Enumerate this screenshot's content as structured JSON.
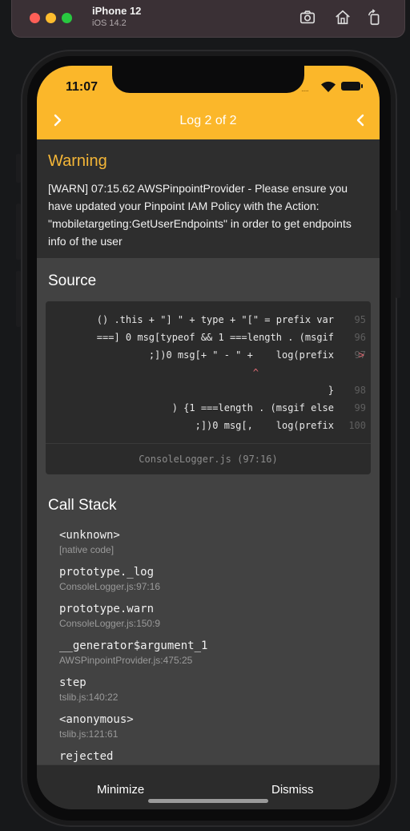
{
  "simulator": {
    "device_name": "iPhone 12",
    "os_version": "iOS 14.2"
  },
  "status_bar": {
    "time": "11:07",
    "cell_dots": "....."
  },
  "header": {
    "title": "Log 2 of 2"
  },
  "warning": {
    "title": "Warning",
    "message": "[WARN] 07:15.62 AWSPinpointProvider - Please ensure you have updated your Pinpoint IAM Policy with the Action: \"mobiletargeting:GetUserEndpoints\" in order to get endpoints info of the user"
  },
  "source": {
    "title": "Source",
    "lines": [
      {
        "text": "() .this + \"] \" + type + \"[\" = prefix var",
        "num": "95",
        "marker": ""
      },
      {
        "text": "===] 0 msg[typeof && 1 ===length . (msgif",
        "num": "96",
        "marker": ""
      },
      {
        "text": ";])0 msg[+ \" - \" +    log(prefix",
        "num": "97",
        "marker": ">"
      },
      {
        "text": "^",
        "num": "",
        "marker": ""
      },
      {
        "text": "}",
        "num": "98",
        "marker": ""
      },
      {
        "text": ") {1 ===length . (msgif else",
        "num": "99",
        "marker": ""
      },
      {
        "text": ";])0 msg[,    log(prefix",
        "num": "100",
        "marker": ""
      }
    ],
    "file_location": "ConsoleLogger.js (97:16)"
  },
  "call_stack": {
    "title": "Call Stack",
    "frames": [
      {
        "fn": "<unknown>",
        "file": "[native code]"
      },
      {
        "fn": "prototype._log",
        "file": "ConsoleLogger.js:97:16"
      },
      {
        "fn": "prototype.warn",
        "file": "ConsoleLogger.js:150:9"
      },
      {
        "fn": "__generator$argument_1",
        "file": "AWSPinpointProvider.js:475:25"
      },
      {
        "fn": "step",
        "file": "tslib.js:140:22"
      },
      {
        "fn": "<anonymous>",
        "file": "tslib.js:121:61"
      },
      {
        "fn": "rejected",
        "file": ""
      }
    ]
  },
  "footer": {
    "minimize": "Minimize",
    "dismiss": "Dismiss"
  }
}
